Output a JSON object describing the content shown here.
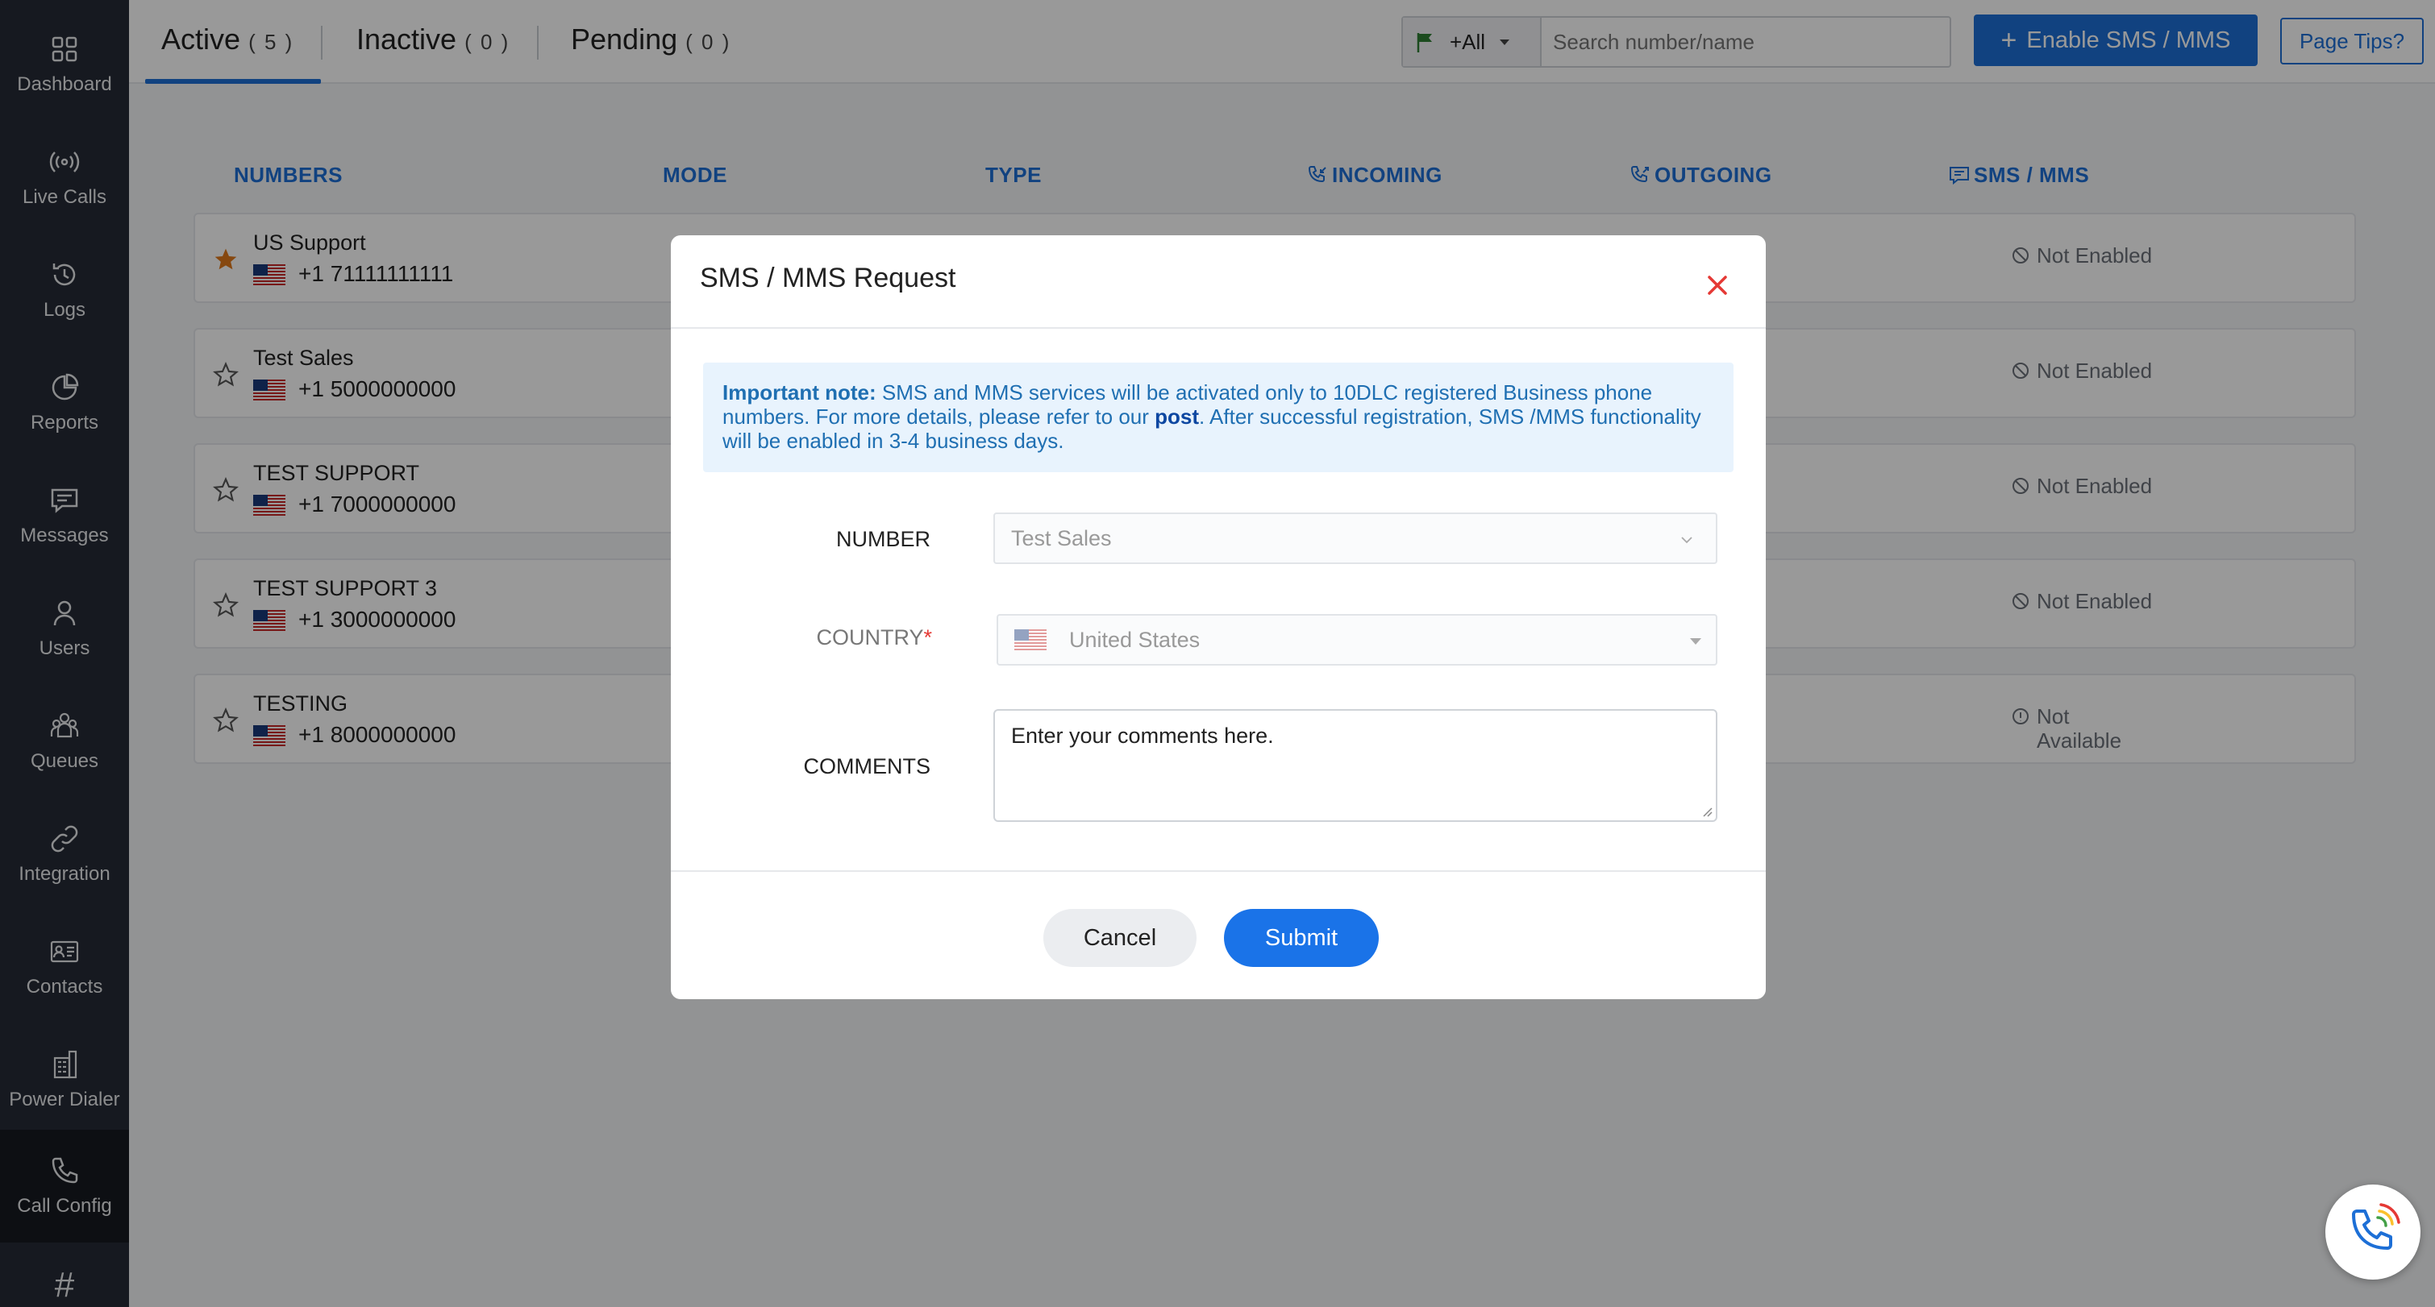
{
  "sidebar": {
    "items": [
      {
        "label": "Dashboard",
        "icon": "grid-icon"
      },
      {
        "label": "Live Calls",
        "icon": "broadcast-icon"
      },
      {
        "label": "Logs",
        "icon": "history-icon"
      },
      {
        "label": "Reports",
        "icon": "pie-chart-icon"
      },
      {
        "label": "Messages",
        "icon": "message-icon"
      },
      {
        "label": "Users",
        "icon": "user-icon"
      },
      {
        "label": "Queues",
        "icon": "group-icon"
      },
      {
        "label": "Integration",
        "icon": "link-icon"
      },
      {
        "label": "Contacts",
        "icon": "contact-card-icon"
      },
      {
        "label": "Power Dialer",
        "icon": "building-icon"
      },
      {
        "label": "Call Config",
        "icon": "phone-icon"
      },
      {
        "label": "#",
        "icon": "hash-icon"
      }
    ],
    "active": "Call Config"
  },
  "tabs": [
    {
      "label": "Active",
      "count": "( 5 )"
    },
    {
      "label": "Inactive",
      "count": "( 0 )"
    },
    {
      "label": "Pending",
      "count": "( 0 )"
    }
  ],
  "search": {
    "country": "+All",
    "placeholder": "Search number/name"
  },
  "toolbar": {
    "enable_label": "Enable SMS / MMS",
    "tips_label": "Page Tips?"
  },
  "columns": {
    "numbers": "NUMBERS",
    "mode": "MODE",
    "type": "TYPE",
    "incoming": "INCOMING",
    "outgoing": "OUTGOING",
    "sms": "SMS / MMS"
  },
  "rows": [
    {
      "name": "US Support",
      "number": "+1 71111111111",
      "starred": true,
      "sms": "Not Enabled"
    },
    {
      "name": "Test Sales",
      "number": "+1 5000000000",
      "starred": false,
      "sms": "Not Enabled"
    },
    {
      "name": "TEST SUPPORT",
      "number": "+1 7000000000",
      "starred": false,
      "sms": "Not Enabled"
    },
    {
      "name": "TEST SUPPORT 3",
      "number": "+1 3000000000",
      "starred": false,
      "sms": "Not Enabled"
    },
    {
      "name": "TESTING",
      "number": "+1 8000000000",
      "starred": false,
      "sms_line1": "Not",
      "sms_line2": "Available"
    }
  ],
  "modal": {
    "title": "SMS / MMS Request",
    "note_bold": "Important note:",
    "note_text1": " SMS and MMS services will be activated only to 10DLC registered Business phone numbers. For more details, please refer to our ",
    "note_link": "post",
    "note_text2": ". After successful registration, SMS /MMS functionality will be enabled in 3-4 business days.",
    "number_label": "NUMBER",
    "number_value": "Test Sales",
    "country_label": "COUNTRY",
    "country_required": "*",
    "country_value": "United States",
    "comments_label": "COMMENTS",
    "comments_placeholder": "Enter your comments here.",
    "cancel_label": "Cancel",
    "submit_label": "Submit"
  },
  "colors": {
    "accent": "#1d6fd6",
    "sidebar": "#262b36",
    "star": "#e0781b",
    "close": "#e53935"
  }
}
